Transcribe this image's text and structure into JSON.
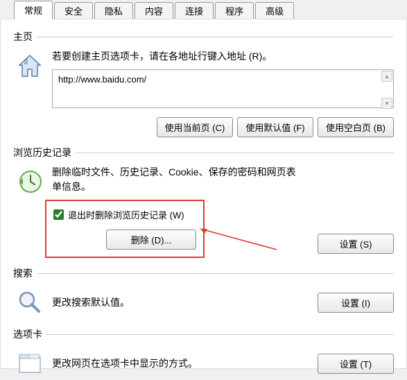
{
  "tabs": {
    "general": "常规",
    "security": "安全",
    "privacy": "隐私",
    "content": "内容",
    "connections": "连接",
    "programs": "程序",
    "advanced": "高级"
  },
  "homepage": {
    "group_label": "主页",
    "instruction": "若要创建主页选项卡，请在各地址行键入地址 (R)。",
    "url_value": "http://www.baidu.com/",
    "use_current": "使用当前页 (C)",
    "use_default": "使用默认值 (F)",
    "use_blank": "使用空白页 (B)"
  },
  "history": {
    "group_label": "浏览历史记录",
    "desc": "删除临时文件、历史记录、Cookie、保存的密码和网页表单信息。",
    "checkbox_label": "退出时删除浏览历史记录 (W)",
    "delete_btn": "删除 (D)...",
    "settings_btn": "设置 (S)"
  },
  "search": {
    "group_label": "搜索",
    "desc": "更改搜索默认值。",
    "settings_btn": "设置 (I)"
  },
  "tabs_section": {
    "group_label": "选项卡",
    "desc": "更改网页在选项卡中显示的方式。",
    "settings_btn": "设置 (T)"
  }
}
